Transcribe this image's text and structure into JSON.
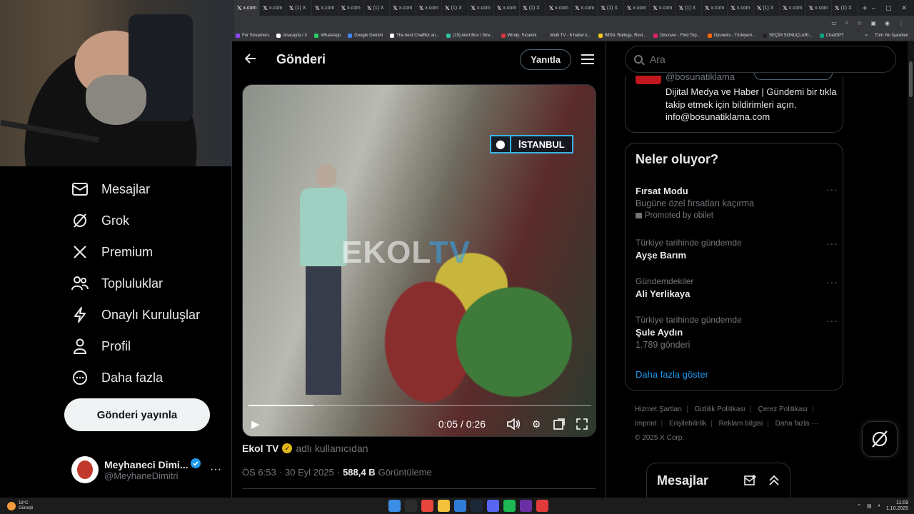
{
  "browser": {
    "tab_label": "x.com",
    "tab_label_alt": "(1) X",
    "tab_count": 24,
    "new_tab": "+",
    "window_controls": [
      "–",
      "▢",
      "✕"
    ],
    "toolbar_icons": [
      "cast-icon",
      "zoom-icon",
      "bookmark-icon",
      "extensions-icon",
      "profile-icon",
      "menu-icon"
    ],
    "bookmarks": [
      {
        "label": "For Streamers",
        "color": "#9146ff"
      },
      {
        "label": "Anasayfa / X",
        "color": "#ffffff"
      },
      {
        "label": "WhatsApp",
        "color": "#25d366"
      },
      {
        "label": "Google Gemini",
        "color": "#4285f4"
      },
      {
        "label": "The best ChatBot an...",
        "color": "#ffffff"
      },
      {
        "label": "(19) Alert Box / Stre...",
        "color": "#31c3a2"
      },
      {
        "label": "Windy: Sıcaklık",
        "color": "#d9363e"
      },
      {
        "label": "Multi TV - 6 haber k...",
        "color": "#333333"
      },
      {
        "label": "IMDb: Ratings, Revi...",
        "color": "#f5c518"
      },
      {
        "label": "Discover - Find Top...",
        "color": "#e0245e"
      },
      {
        "label": "Oyuneks - Türkiyeni...",
        "color": "#ff6600"
      },
      {
        "label": "SEÇİM SONUÇLARI...",
        "color": "#222222"
      },
      {
        "label": "ChatGPT",
        "color": "#10a37f"
      }
    ],
    "bookmarks_more": "»",
    "all_bookmarks": "Tüm Yer İşaretleri"
  },
  "nav": {
    "items": [
      {
        "label": "Mesajlar",
        "icon": "envelope-icon"
      },
      {
        "label": "Grok",
        "icon": "grok-icon"
      },
      {
        "label": "Premium",
        "icon": "x-logo-icon"
      },
      {
        "label": "Topluluklar",
        "icon": "communities-icon"
      },
      {
        "label": "Onaylı Kuruluşlar",
        "icon": "lightning-icon"
      },
      {
        "label": "Profil",
        "icon": "person-icon"
      },
      {
        "label": "Daha fazla",
        "icon": "more-circle-icon"
      }
    ],
    "post_button": "Gönderi yayınla",
    "account": {
      "display_name": "Meyhaneci Dimi...",
      "handle": "@MeyhaneDimitri",
      "more": "···"
    }
  },
  "main": {
    "title": "Gönderi",
    "reply_button": "Yanıtla",
    "video": {
      "location_label": "İSTANBUL",
      "watermark_a": "EKOL",
      "watermark_b": "TV",
      "current_time": "0:05",
      "duration": "0:26",
      "time_sep": " / ",
      "progress": 0.19
    },
    "attribution": {
      "source": "Ekol TV",
      "suffix": "adlı kullanıcıdan"
    },
    "meta": {
      "time": "ÖS 6:53",
      "sep": "·",
      "date": "30 Eyl 2025",
      "views_count": "588,4 B",
      "views_label": "Görüntüleme"
    }
  },
  "right": {
    "search_placeholder": "Ara",
    "promo": {
      "handle": "@bosunatiklama",
      "bio": "Dijital Medya ve Haber | Gündemi bir tıkla takip etmek için bildirimleri açın. info@bosunatiklama.com"
    },
    "trends": {
      "title": "Neler oluyor?",
      "items": [
        {
          "ctx": "",
          "name": "Fırsat Modu",
          "sub": "Bugüne özel fırsatları kaçırma",
          "promo": "Promoted by obilet"
        },
        {
          "ctx": "Türkiye tarihinde gündemde",
          "name": "Ayşe Barım",
          "sub": "",
          "promo": ""
        },
        {
          "ctx": "Gündemdekiler",
          "name": "Ali Yerlikaya",
          "sub": "",
          "promo": ""
        },
        {
          "ctx": "Türkiye tarihinde gündemde",
          "name": "Şule Aydın",
          "sub": "1.789 gönderi",
          "promo": ""
        }
      ],
      "dots": "···",
      "show_more": "Daha fazla göster"
    },
    "footer": {
      "links": [
        "Hizmet Şartları",
        "Gizlilik Politikası",
        "Çerez Politikası",
        "Imprint",
        "Erişilebilirlik",
        "Reklam bilgisi",
        "Daha fazla ···"
      ],
      "copyright": "© 2025 X Corp."
    },
    "messages_drawer": "Mesajlar"
  },
  "taskbar": {
    "temp": "18°C",
    "weather": "Güneşli",
    "time": "11:09",
    "date": "1.10.2025",
    "apps": [
      {
        "name": "windows-start-icon",
        "color": "#3a8ee6"
      },
      {
        "name": "search-icon",
        "color": "#2b2b2b"
      },
      {
        "name": "chrome-icon",
        "color": "#e8453c"
      },
      {
        "name": "file-explorer-icon",
        "color": "#f3c13a"
      },
      {
        "name": "app-icon-1",
        "color": "#2f7bd6"
      },
      {
        "name": "steam-icon",
        "color": "#1b2838"
      },
      {
        "name": "discord-icon",
        "color": "#5865f2"
      },
      {
        "name": "spotify-icon",
        "color": "#1db954"
      },
      {
        "name": "app-icon-2",
        "color": "#6b2fa5"
      },
      {
        "name": "app-icon-3",
        "color": "#e23a3a"
      }
    ]
  }
}
